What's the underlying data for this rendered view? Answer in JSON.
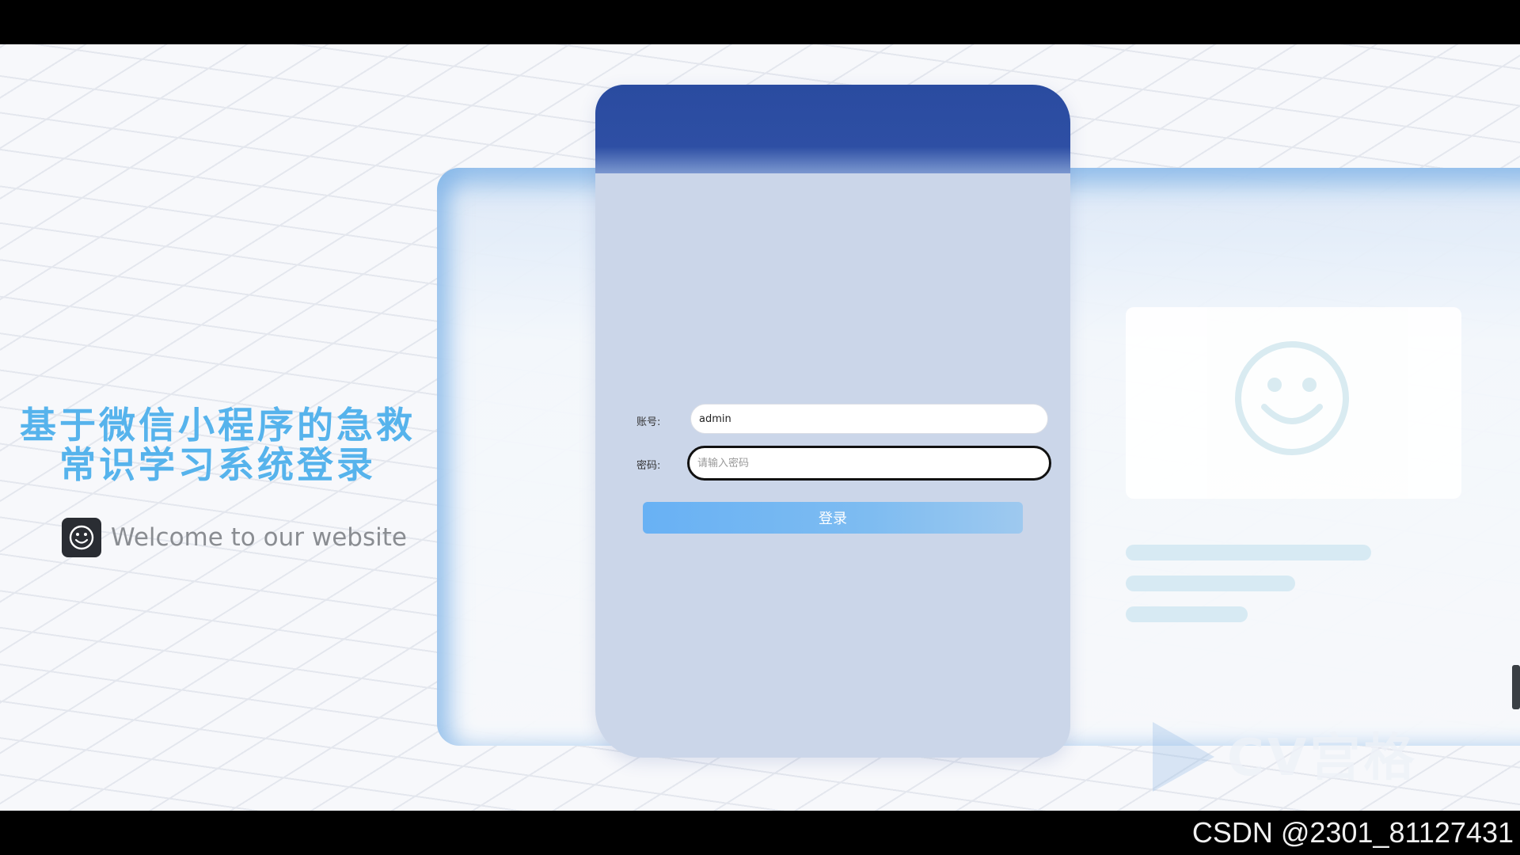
{
  "page": {
    "title": "基于微信小程序的急救常识学习系统登录",
    "title_line1": "基于微信小程序的急救",
    "title_line2": "常识学习系统登录",
    "welcome": "Welcome to our website"
  },
  "login": {
    "account_label": "账号:",
    "account_value": "admin",
    "password_label": "密码:",
    "password_placeholder": "请输入密码",
    "submit_label": "登录"
  },
  "brand": {
    "logo_text": "CV宫格"
  },
  "footer": {
    "watermark": "CSDN @2301_81127431"
  },
  "colors": {
    "title": "#56b3ec",
    "header_blue": "#2a4ba0",
    "card_bg": "#cbd6e9",
    "button": "#68b1f4"
  }
}
